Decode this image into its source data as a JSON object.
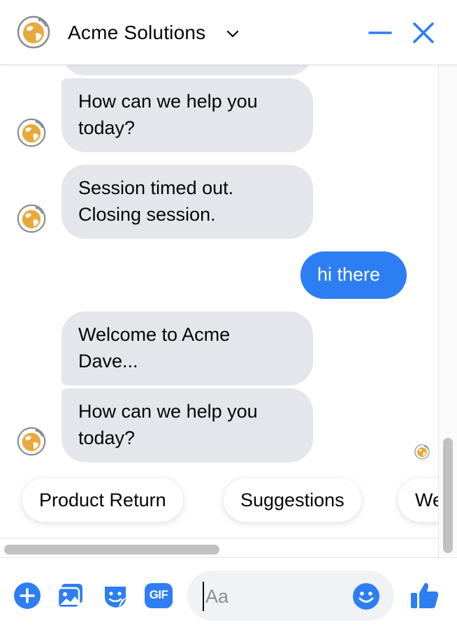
{
  "header": {
    "title": "Acme Solutions",
    "avatar_icon": "globe-logo-icon",
    "dropdown_icon": "chevron-down-icon",
    "minimize_icon": "minimize-icon",
    "close_icon": "close-icon"
  },
  "messages": [
    {
      "from": "bot",
      "text": "How can we help you\ntoday?"
    },
    {
      "from": "bot",
      "text": "Session timed out.\nClosing session."
    },
    {
      "from": "user",
      "text": "hi there"
    },
    {
      "from": "bot",
      "text": "Welcome to Acme\nDave..."
    },
    {
      "from": "bot",
      "text": "How can we help you\ntoday?"
    }
  ],
  "quick_replies": [
    "Product Return",
    "Suggestions",
    "We"
  ],
  "composer": {
    "placeholder": "Aa",
    "value": "",
    "icons": [
      "plus-icon",
      "photo-icon",
      "sticker-icon",
      "gif-icon",
      "emoji-icon",
      "thumbs-up-icon"
    ],
    "gif_label": "GIF"
  },
  "colors": {
    "accent": "#2d7ef2",
    "bot_bubble": "#e4e6eb",
    "logo_yellow": "#e8a93b"
  }
}
